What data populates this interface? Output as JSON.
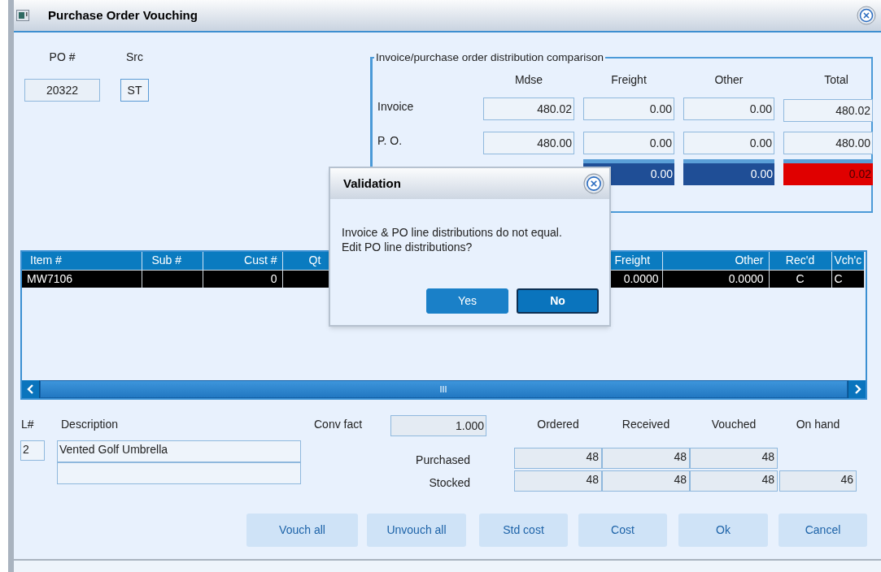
{
  "window": {
    "title": "Purchase Order Vouching"
  },
  "header": {
    "po_label": "PO #",
    "po_value": "20322",
    "src_label": "Src",
    "src_value": "ST"
  },
  "distribution": {
    "title": "Invoice/purchase order distribution comparison",
    "columns": [
      "Mdse",
      "Freight",
      "Other",
      "Total"
    ],
    "rows": [
      {
        "kind": "amounts",
        "label": "Invoice",
        "cells": [
          "480.02",
          "0.00",
          "0.00",
          "480.02"
        ]
      },
      {
        "kind": "amounts",
        "label": "P. O.",
        "cells": [
          "480.00",
          "0.00",
          "0.00",
          "480.00"
        ]
      },
      {
        "kind": "difference",
        "cells": [
          {},
          {
            "value": "0.00",
            "color": "#1f4e96"
          },
          {
            "value": "0.00",
            "color": "#1f4e96"
          },
          {
            "value": "0.02",
            "color": "#e00000"
          }
        ]
      }
    ]
  },
  "grid": {
    "columns": [
      "Item #",
      "Sub #",
      "Cust #",
      "Qt",
      "Freight",
      "Other",
      "Rec'd",
      "Vch'c"
    ],
    "rows": [
      {
        "selected": true,
        "cells": [
          "MW7106",
          null,
          "0",
          null,
          "0.0000",
          "0.0000",
          "C",
          "C"
        ]
      }
    ]
  },
  "line": {
    "line_label": "L#",
    "line_no": "2",
    "description_label": "Description",
    "description": "Vented Golf Umbrella",
    "conv_fact_label": "Conv fact",
    "conv_fact": "1.000",
    "qty_columns": [
      "Ordered",
      "Received",
      "Vouched",
      "On hand"
    ],
    "qty_rows": [
      {
        "label": "Purchased",
        "values": [
          "48",
          "48",
          "48"
        ]
      },
      {
        "label": "Stocked",
        "values": [
          "48",
          "48",
          "48",
          "46"
        ]
      }
    ]
  },
  "buttons": [
    "Vouch all",
    "Unvouch all",
    "Std cost",
    "Cost",
    "Ok",
    "Cancel"
  ],
  "dialog": {
    "title": "Validation",
    "message": "Invoice & PO line distributions do not equal.\nEdit PO line distributions?",
    "buttons": [
      {
        "label": "Yes",
        "focused": false
      },
      {
        "label": "No",
        "focused": true
      }
    ]
  }
}
